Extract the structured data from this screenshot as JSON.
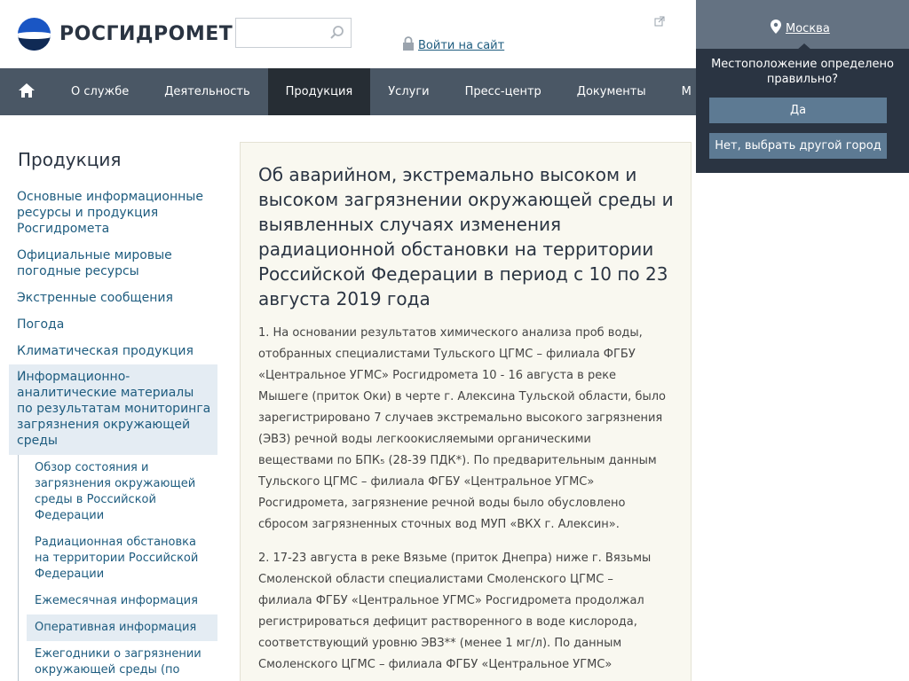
{
  "header": {
    "logo_text": "РОСГИДРОМЕТ",
    "search_placeholder": "",
    "login_label": "Войти на сайт"
  },
  "nav": {
    "items": [
      {
        "label": "О службе",
        "active": false
      },
      {
        "label": "Деятельность",
        "active": false
      },
      {
        "label": "Продукция",
        "active": true
      },
      {
        "label": "Услуги",
        "active": false
      },
      {
        "label": "Пресс-центр",
        "active": false
      },
      {
        "label": "Документы",
        "active": false
      },
      {
        "label": "М",
        "active": false
      }
    ]
  },
  "location": {
    "city": "Москва",
    "question": "Местоположение определено правильно?",
    "yes_label": "Да",
    "no_label": "Нет, выбрать другой город"
  },
  "sidebar": {
    "title": "Продукция",
    "items": [
      {
        "label": "Основные информационные ресурсы и продукция Росгидромета"
      },
      {
        "label": "Официальные мировые погодные ресурсы"
      },
      {
        "label": "Экстренные сообщения"
      },
      {
        "label": "Погода"
      },
      {
        "label": "Климатическая продукция"
      },
      {
        "label": "Информационно-аналитические материалы по результатам мониторинга загрязнения окружающей среды"
      }
    ],
    "subitems": [
      {
        "label": "Обзор состояния и загрязнения окружающей среды в Российской Федерации"
      },
      {
        "label": "Радиационная обстановка на территории Российской Федерации"
      },
      {
        "label": "Ежемесячная информация"
      },
      {
        "label": "Оперативная информация"
      },
      {
        "label": "Ежегодники о загрязнении окружающей среды (по"
      }
    ]
  },
  "article": {
    "title": "Об аварийном, экстремально высоком и высоком загрязнении окружающей среды и выявленных случаях изменения радиационной обстановки на территории Российской Федерации в период с 10 по 23 августа 2019 года",
    "p1": "1. На основании результатов химического анализа проб воды, отобранных специалистами Тульского ЦГМС – филиала ФГБУ «Центральное УГМС» Росгидромета 10 - 16 августа в реке Мышеге (приток Оки) в черте г. Алексина Тульской области, было зарегистрировано 7 случаев экстремально высокого загрязнения (ЭВЗ) речной воды легкоокисляемыми органическими веществами по БПК₅ (28-39 ПДК*). По предварительным данным Тульского ЦГМС – филиала ФГБУ «Центральное УГМС» Росгидромета, загрязнение речной воды было обусловлено сбросом загрязненных сточных вод МУП «ВКХ г. Алексин».",
    "p2": "2. 17-23 августа в реке Вязьме (приток Днепра) ниже г. Вязьмы Смоленской области специалистами Смоленского ЦГМС – филиала ФГБУ «Центральное УГМС» Росгидромета продолжал регистрироваться дефицит растворенного в воде кислорода, соответствующий уровню ЭВЗ** (менее 1 мг/л). По данным Смоленского ЦГМС – филиала ФГБУ «Центральное УГМС»"
  },
  "colors": {
    "nav_bg": "#4a5765",
    "nav_active": "#262d34",
    "link": "#1e5c7f",
    "panel_dark": "#2a3442",
    "content_bg": "#f9f8f0"
  }
}
